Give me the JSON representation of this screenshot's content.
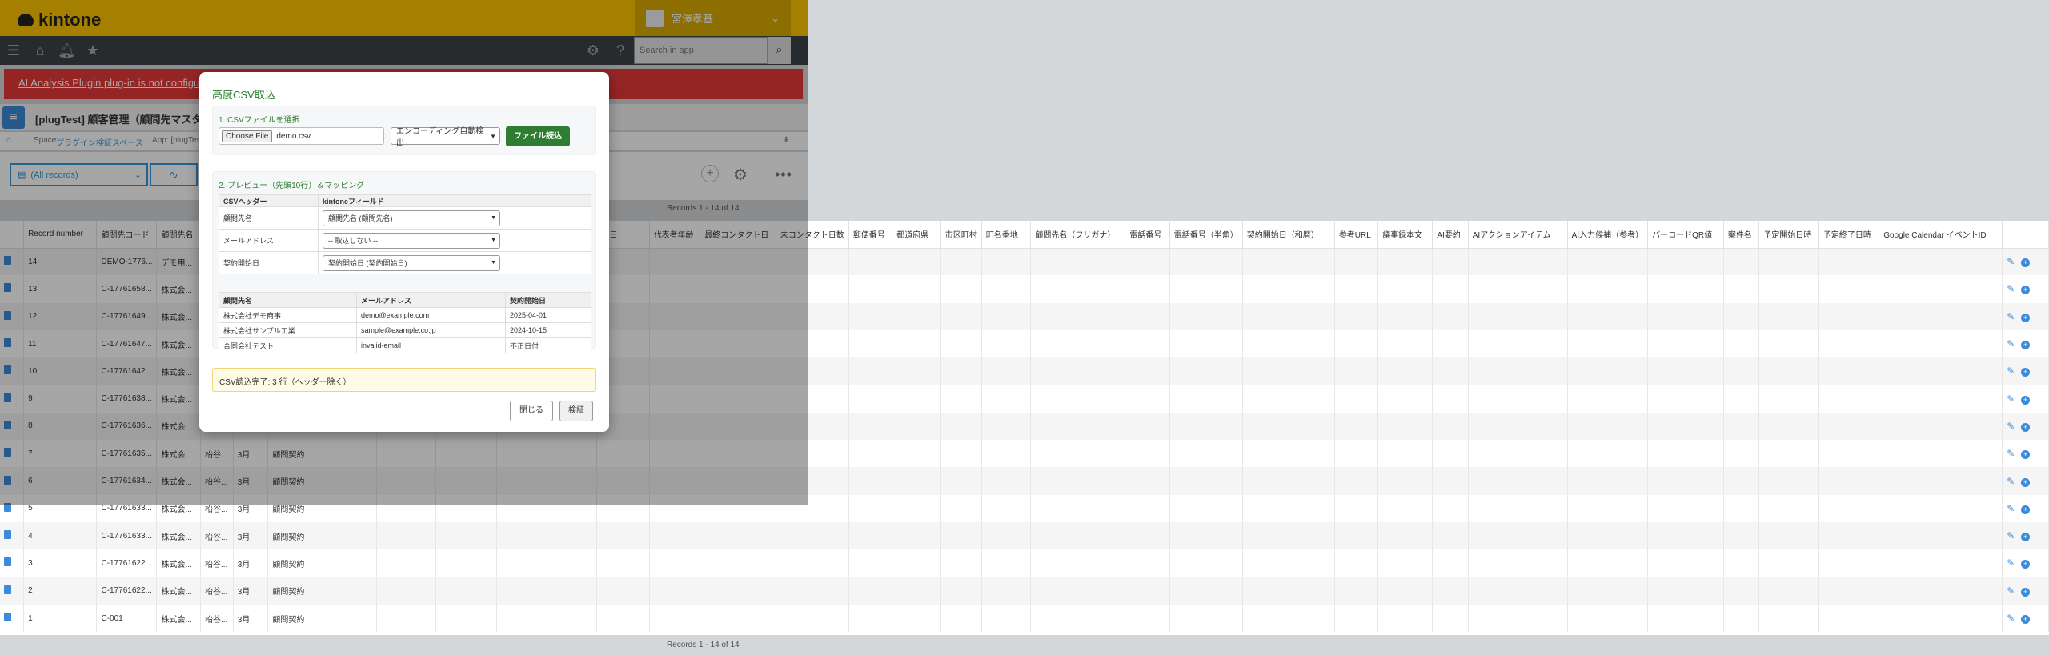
{
  "app": {
    "logo_text": "kintone",
    "user_name": "宮澤孝基",
    "search_placeholder": "Search in app",
    "error_message": "AI Analysis Plugin plug-in is not configured",
    "title": "[plugTest] 顧客管理（顧問先マスタ）",
    "breadcrumb_space_label": "Space:",
    "breadcrumb_space": "プラグイン検証スペース",
    "breadcrumb_app_label": "App: [plugTest]",
    "view_name": "(All records)",
    "record_count": "Records 1 - 14 of 14"
  },
  "table": {
    "columns": [
      "",
      "Record number",
      "顧問先コード",
      "顧問先名",
      "",
      "",
      "",
      "",
      "",
      "",
      "",
      "",
      "月日",
      "代表者年齢",
      "最終コンタクト日",
      "未コンタクト日数",
      "郵便番号",
      "都道府県",
      "市区町村",
      "町名番地",
      "顧問先名（フリガナ）",
      "電話番号",
      "電話番号（半角）",
      "契約開始日（和暦）",
      "参考URL",
      "議事録本文",
      "AI要約",
      "AIアクションアイテム",
      "AI入力候補（参考）",
      "バーコードQR値",
      "案件名",
      "予定開始日時",
      "予定終了日時",
      "Google Calendar イベントID",
      ""
    ],
    "rows": [
      {
        "num": "14",
        "code": "DEMO-1776...",
        "name": "デモ用...",
        "c3": "",
        "c4": "",
        "c5": ""
      },
      {
        "num": "13",
        "code": "C-17761658...",
        "name": "株式会...",
        "c3": "",
        "c4": "",
        "c5": ""
      },
      {
        "num": "12",
        "code": "C-17761649...",
        "name": "株式会...",
        "c3": "",
        "c4": "",
        "c5": ""
      },
      {
        "num": "11",
        "code": "C-17761647...",
        "name": "株式会...",
        "c3": "",
        "c4": "",
        "c5": ""
      },
      {
        "num": "10",
        "code": "C-17761642...",
        "name": "株式会...",
        "c3": "",
        "c4": "",
        "c5": ""
      },
      {
        "num": "9",
        "code": "C-17761638...",
        "name": "株式会...",
        "c3": "",
        "c4": "",
        "c5": ""
      },
      {
        "num": "8",
        "code": "C-17761636...",
        "name": "株式会...",
        "c3": "",
        "c4": "",
        "c5": ""
      },
      {
        "num": "7",
        "code": "C-17761635...",
        "name": "株式会...",
        "c3": "柗谷...",
        "c4": "3月",
        "c5": "顧問契約"
      },
      {
        "num": "6",
        "code": "C-17761634...",
        "name": "株式会...",
        "c3": "柗谷...",
        "c4": "3月",
        "c5": "顧問契約"
      },
      {
        "num": "5",
        "code": "C-17761633...",
        "name": "株式会...",
        "c3": "柗谷...",
        "c4": "3月",
        "c5": "顧問契約"
      },
      {
        "num": "4",
        "code": "C-17761633...",
        "name": "株式会...",
        "c3": "柗谷...",
        "c4": "3月",
        "c5": "顧問契約"
      },
      {
        "num": "3",
        "code": "C-17761622...",
        "name": "株式会...",
        "c3": "柗谷...",
        "c4": "3月",
        "c5": "顧問契約"
      },
      {
        "num": "2",
        "code": "C-17761622...",
        "name": "株式会...",
        "c3": "柗谷...",
        "c4": "3月",
        "c5": "顧問契約"
      },
      {
        "num": "1",
        "code": "C-001",
        "name": "株式会...",
        "c3": "柗谷...",
        "c4": "3月",
        "c5": "顧問契約"
      }
    ]
  },
  "modal": {
    "title": "高度CSV取込",
    "section1_title": "1. CSVファイルを選択",
    "choose_file_label": "Choose File",
    "file_name": "demo.csv",
    "encoding_option": "エンコーディング自動検出",
    "load_button": "ファイル読込",
    "section2_title": "2. プレビュー（先頭10行）＆マッピング",
    "mapping_headers": [
      "CSVヘッダー",
      "kintoneフィールド"
    ],
    "mapping_rows": [
      {
        "csv": "顧問先名",
        "field": "顧問先名 (顧問先名)"
      },
      {
        "csv": "メールアドレス",
        "field": "-- 取込しない --"
      },
      {
        "csv": "契約開始日",
        "field": "契約開始日 (契約開始日)"
      }
    ],
    "preview_headers": [
      "顧問先名",
      "メールアドレス",
      "契約開始日"
    ],
    "preview_rows": [
      [
        "株式会社デモ商事",
        "demo@example.com",
        "2025-04-01"
      ],
      [
        "株式会社サンプル工業",
        "sample@example.co.jp",
        "2024-10-15"
      ],
      [
        "合同会社テスト",
        "invalid-email",
        "不正日付"
      ]
    ],
    "status_message": "CSV読込完了: 3 行（ヘッダー除く）",
    "close_button": "閉じる",
    "verify_button": "検証"
  }
}
